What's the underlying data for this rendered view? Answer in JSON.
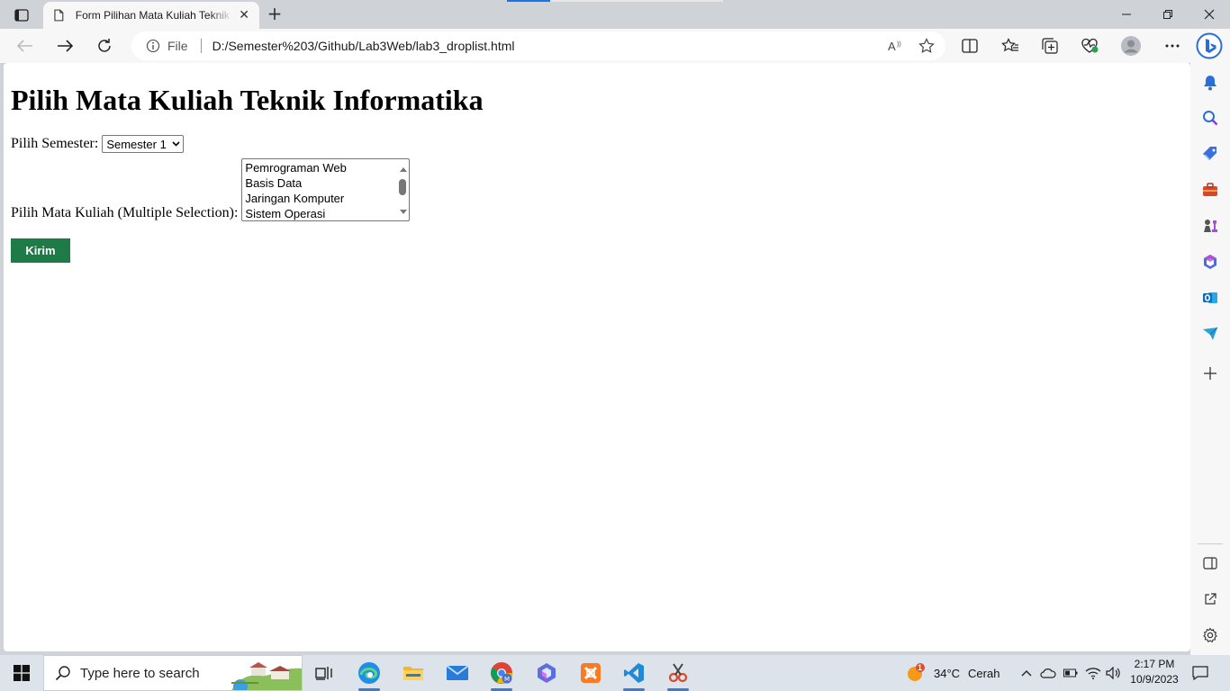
{
  "browser": {
    "tab_title": "Form Pilihan Mata Kuliah Teknik Informatika",
    "file_label": "File",
    "url": "D:/Semester%203/Github/Lab3Web/lab3_droplist.html"
  },
  "page": {
    "heading": "Pilih Mata Kuliah Teknik Informatika",
    "semester_label": "Pilih Semester:",
    "semester_selected": "Semester 1",
    "matkul_label": "Pilih Mata Kuliah (Multiple Selection):",
    "matkul_options": [
      "Pemrograman Web",
      "Basis Data",
      "Jaringan Komputer",
      "Sistem Operasi"
    ],
    "submit_label": "Kirim"
  },
  "taskbar": {
    "search_placeholder": "Type here to search",
    "weather_temp": "34°C",
    "weather_text": "Cerah",
    "weather_badge": "1",
    "time": "2:17 PM",
    "date": "10/9/2023"
  },
  "colors": {
    "submit_button": "#1e7a46",
    "accent": "#1a73e8"
  }
}
